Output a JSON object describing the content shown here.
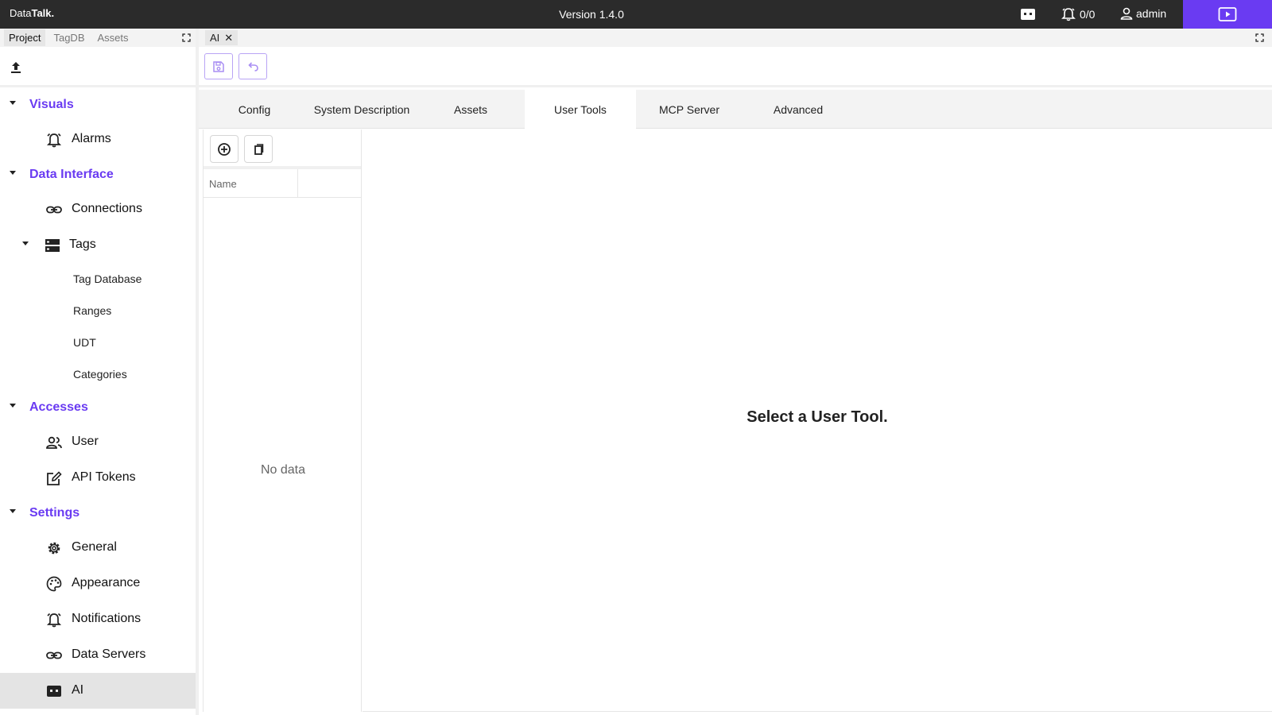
{
  "app": {
    "brand_prefix": "Data",
    "brand_suffix": "Talk.",
    "version": "Version 1.4.0"
  },
  "topbar": {
    "alarm_count": "0/0",
    "user_name": "admin",
    "accent_color": "#6a3bf2"
  },
  "left_panel": {
    "tabs": [
      {
        "label": "Project",
        "active": true
      },
      {
        "label": "TagDB",
        "active": false
      },
      {
        "label": "Assets",
        "active": false
      }
    ],
    "groups": {
      "visuals": {
        "label": "Visuals",
        "items": {
          "alarms": "Alarms"
        }
      },
      "data_interface": {
        "label": "Data Interface",
        "items": {
          "connections": "Connections",
          "tags": "Tags"
        },
        "tags_children": [
          "Tag Database",
          "Ranges",
          "UDT",
          "Categories"
        ]
      },
      "accesses": {
        "label": "Accesses",
        "items": {
          "user": "User",
          "api_tokens": "API Tokens"
        }
      },
      "settings": {
        "label": "Settings",
        "items": {
          "general": "General",
          "appearance": "Appearance",
          "notifications": "Notifications",
          "data_servers": "Data Servers",
          "ai": "AI"
        }
      }
    },
    "selected_item": "AI"
  },
  "editor": {
    "open_tab": "AI",
    "subtabs": [
      "Config",
      "System Description",
      "Assets",
      "User Tools",
      "MCP Server",
      "Advanced"
    ],
    "active_subtab": "User Tools",
    "list": {
      "column_name": "Name",
      "empty_text": "No data"
    },
    "placeholder": "Select a User Tool."
  }
}
